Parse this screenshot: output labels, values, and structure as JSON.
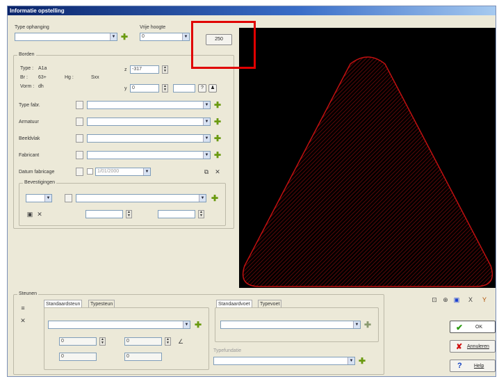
{
  "window": {
    "title": "Informatie opstelling"
  },
  "top": {
    "type_label": "Type ophanging",
    "height_label": "Vrije hoogte",
    "height_value": "0",
    "preview_btn": "250"
  },
  "borden": {
    "title": "Borden",
    "type_k": "Type :",
    "type_v": "A1a",
    "br_k": "Br :",
    "br_v": "63+",
    "hg_k": "Hg :",
    "hg_v": "Sxx",
    "vorm_k": "Vorm :",
    "vorm_v": "dh",
    "x_label": "z",
    "x_value": "-317",
    "y_label": "y",
    "y_value": "0",
    "rows": [
      "Type fabr.",
      "Armatuur",
      "Beeldvlak",
      "Fabricant"
    ],
    "date_label": "Datum fabricage",
    "date_value": "1/01/2000"
  },
  "bevestigingen": {
    "title": "Bevestigingen"
  },
  "steunen": {
    "title": "Steunen",
    "tab1": "Standaardsteun",
    "tab2": "Typesteun",
    "tab3": "Standaardvoet",
    "tab4": "Typevoet",
    "typefunder_label": "Typefundatie",
    "v1": "0",
    "v2": "0",
    "v3": "0",
    "v4": "0"
  },
  "actions": {
    "ok": "OK",
    "cancel": "Annuleren",
    "help": "Help"
  },
  "colors": {
    "canvas_bg": "#000000",
    "sign_outline": "#c01010",
    "highlight": "#e00000"
  }
}
